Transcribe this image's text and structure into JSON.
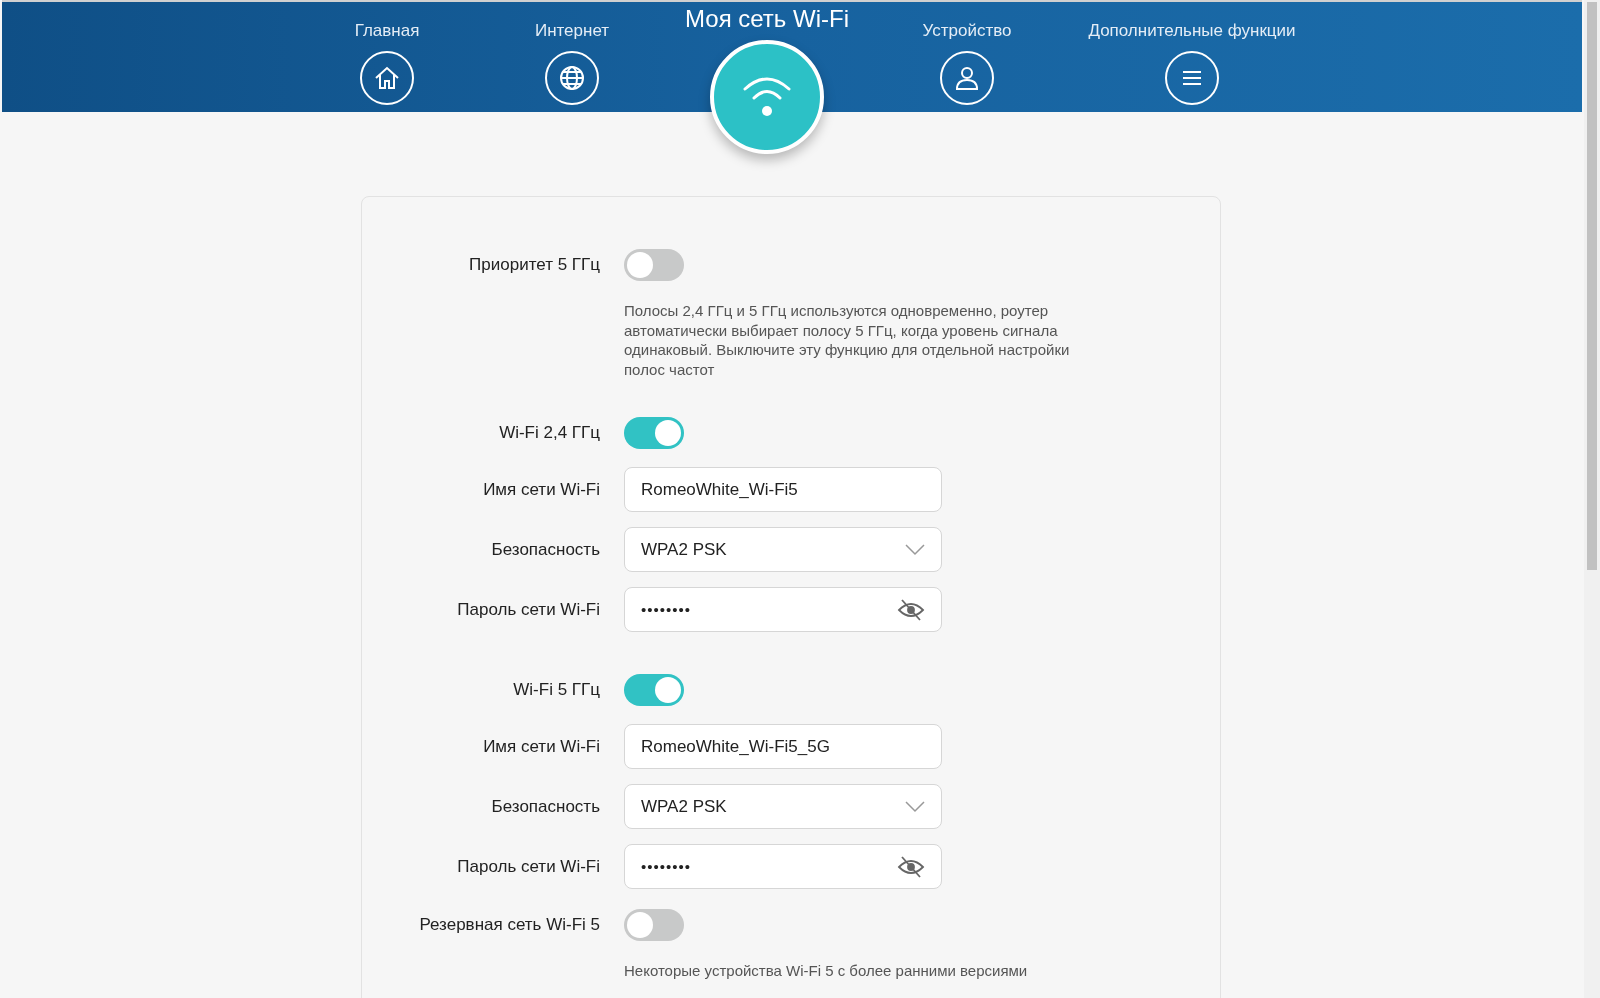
{
  "nav": {
    "items": [
      {
        "label": "Главная",
        "kind": "home",
        "selected": false
      },
      {
        "label": "Интернет",
        "kind": "internet",
        "selected": false
      },
      {
        "label": "Моя сеть Wi-Fi",
        "kind": "wifi",
        "selected": true
      },
      {
        "label": "Устройство",
        "kind": "device",
        "selected": false
      },
      {
        "label": "Дополнительные функции",
        "kind": "more",
        "selected": false
      }
    ]
  },
  "settings": [
    {
      "kind": "toggle",
      "label": "Приоритет 5 ГГц",
      "on": false,
      "description": "Полосы 2,4 ГГц и 5 ГГц используются одновременно, роутер автоматически выбирает полосу 5 ГГц, когда уровень сигнала одинаковый. Выключите эту функцию для отдельной настройки полос частот"
    },
    {
      "kind": "toggle",
      "label": "Wi-Fi 2,4 ГГц",
      "on": true
    },
    {
      "kind": "text",
      "label": "Имя сети Wi-Fi",
      "value": "RomeoWhite_Wi-Fi5"
    },
    {
      "kind": "select",
      "label": "Безопасность",
      "value": "WPA2 PSK"
    },
    {
      "kind": "password",
      "label": "Пароль сети Wi-Fi",
      "value": "••••••••"
    },
    {
      "kind": "toggle",
      "label": "Wi-Fi 5 ГГц",
      "on": true
    },
    {
      "kind": "text",
      "label": "Имя сети Wi-Fi",
      "value": "RomeoWhite_Wi-Fi5_5G"
    },
    {
      "kind": "select",
      "label": "Безопасность",
      "value": "WPA2 PSK"
    },
    {
      "kind": "password",
      "label": "Пароль сети Wi-Fi",
      "value": "••••••••"
    },
    {
      "kind": "toggle",
      "label": "Резервная сеть Wi-Fi 5",
      "on": false,
      "description": "Некоторые устройства Wi-Fi 5 с более ранними версиями"
    }
  ]
}
